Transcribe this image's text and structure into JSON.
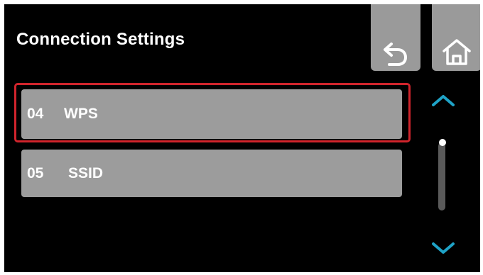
{
  "header": {
    "title": "Connection Settings"
  },
  "toolbar": {
    "back_icon": "back-arrow-icon",
    "home_icon": "home-icon"
  },
  "menu": {
    "items": [
      {
        "number": "04",
        "label": "WPS",
        "selected": true
      },
      {
        "number": "05",
        "label": "SSID",
        "selected": false
      }
    ]
  },
  "scroll": {
    "up_icon": "chevron-up-icon",
    "down_icon": "chevron-down-icon",
    "position": 0
  },
  "colors": {
    "background": "#000000",
    "button": "#9c9c9c",
    "text": "#ffffff",
    "selection": "#d0242c",
    "accent": "#1fa3c7",
    "scroll_track": "#5a5a5a"
  }
}
